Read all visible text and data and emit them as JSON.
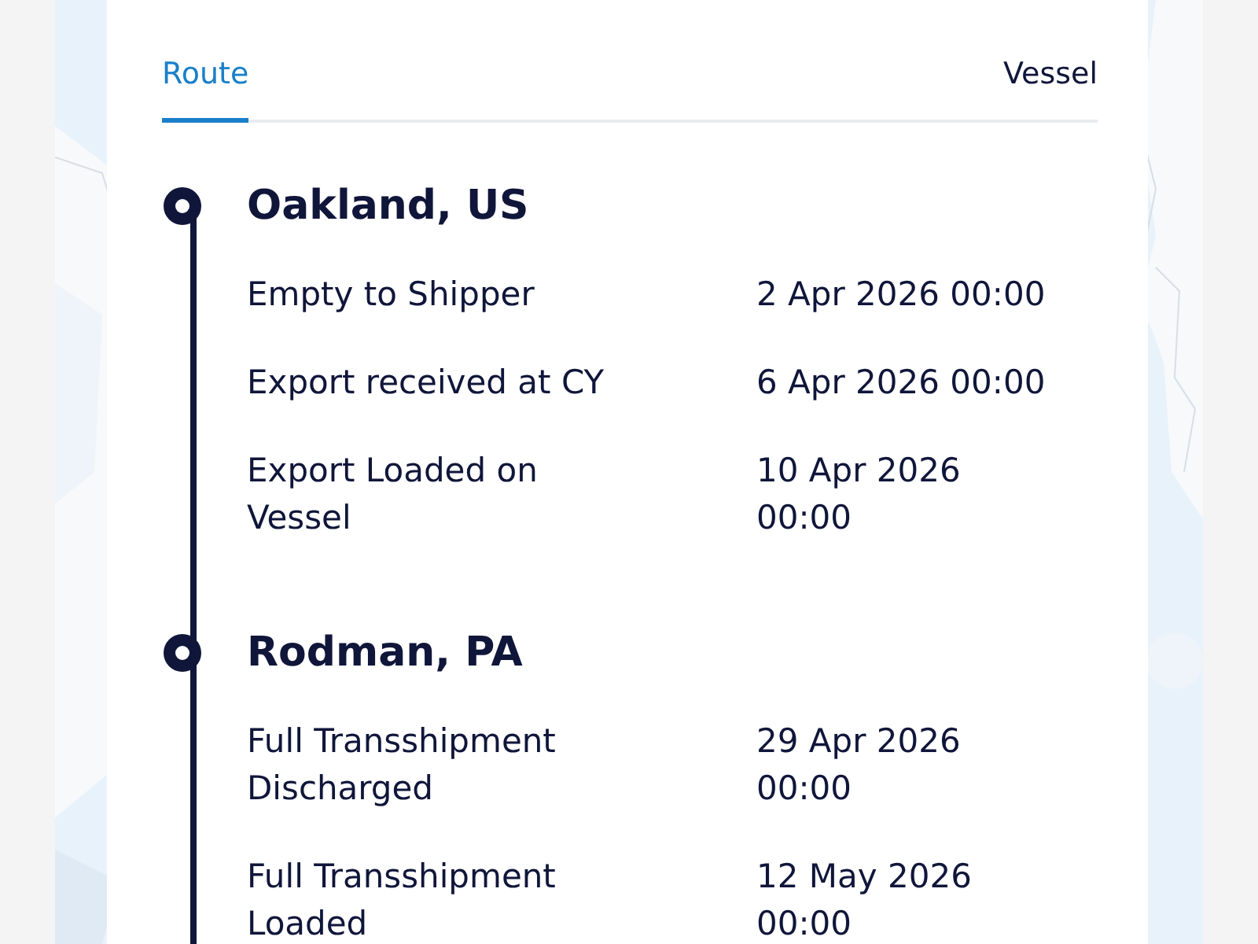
{
  "tabs": [
    {
      "label": "Route",
      "selected": true
    },
    {
      "label": "Vessel",
      "selected": false
    }
  ],
  "stops": [
    {
      "city": "Oakland, US",
      "events": [
        {
          "name": "Empty to Shipper",
          "time": "2 Apr 2026 00:00"
        },
        {
          "name": "Export received at CY",
          "time": "6 Apr 2026 00:00"
        },
        {
          "name": "Export Loaded on Vessel",
          "time": "10 Apr 2026 00:00"
        }
      ]
    },
    {
      "city": "Rodman, PA",
      "events": [
        {
          "name": "Full Transshipment Discharged",
          "time": "29 Apr 2026 00:00"
        },
        {
          "name": "Full Transshipment Loaded",
          "time": "12 May 2026 00:00"
        }
      ]
    }
  ]
}
